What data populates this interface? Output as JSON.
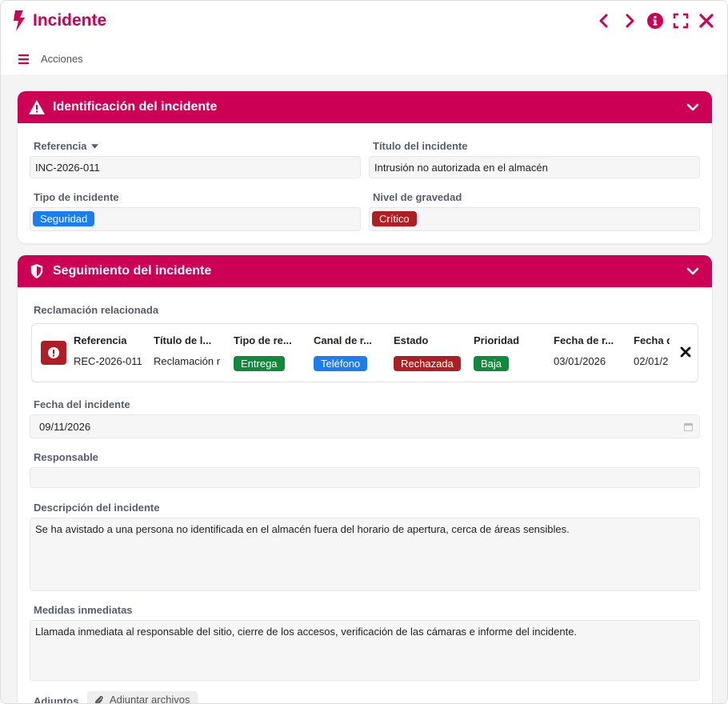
{
  "window": {
    "title": "Incidente",
    "actions_label": "Acciones"
  },
  "colors": {
    "brand": "#cc0055",
    "seguridad": "#1a7ef0",
    "critico": "#b01e24",
    "entrega": "#0f8a3c",
    "telefono": "#1a7ef0",
    "rechazada": "#b01e24",
    "baja": "#0f8a3c"
  },
  "icons": {
    "title": "lightning-bolt-icon",
    "prev": "chevron-left-icon",
    "next": "chevron-right-icon",
    "info": "info-circle-icon",
    "fullscreen": "expand-icon",
    "close": "close-icon",
    "menu": "hamburger-menu-icon",
    "section1": "warning-triangle-icon",
    "section2": "shield-icon",
    "collapse": "chevron-down-icon",
    "claim": "exclamation-circle-icon",
    "remove": "x-icon",
    "date": "calendar-icon",
    "attach": "paperclip-icon"
  },
  "section_identificacion": {
    "title": "Identificación del incidente",
    "referencia_label": "Referencia",
    "referencia_value": "INC-2026-011",
    "titulo_label": "Título del incidente",
    "titulo_value": "Intrusión no autorizada en el almacén",
    "tipo_label": "Tipo de incidente",
    "tipo_value": "Seguridad",
    "nivel_label": "Nivel de gravedad",
    "nivel_value": "Crítico"
  },
  "section_seguimiento": {
    "title": "Seguimiento del incidente",
    "reclamacion_label": "Reclamación relacionada",
    "claim_columns": [
      "Referencia",
      "Título de l...",
      "Tipo de re...",
      "Canal de r...",
      "Estado",
      "Prioridad",
      "Fecha de r...",
      "Fecha d"
    ],
    "claim_row": {
      "referencia": "REC-2026-011",
      "titulo": "Reclamación r",
      "tipo": "Entrega",
      "canal": "Teléfono",
      "estado": "Rechazada",
      "prioridad": "Baja",
      "fecha_r": "03/01/2026",
      "fecha_d": "02/01/2"
    },
    "fecha_label": "Fecha del incidente",
    "fecha_value": "09/11/2026",
    "responsable_label": "Responsable",
    "responsable_value": "",
    "descripcion_label": "Descripción del incidente",
    "descripcion_value": "Se ha avistado a una persona no identificada en el almacén fuera del horario de apertura, cerca de áreas sensibles.",
    "medidas_label": "Medidas inmediatas",
    "medidas_value": "Llamada inmediata al responsable del sitio, cierre de los accesos, verificación de las cámaras e informe del incidente.",
    "adjuntos_label": "Adjuntos",
    "adjuntar_label": "Adjuntar archivos"
  }
}
